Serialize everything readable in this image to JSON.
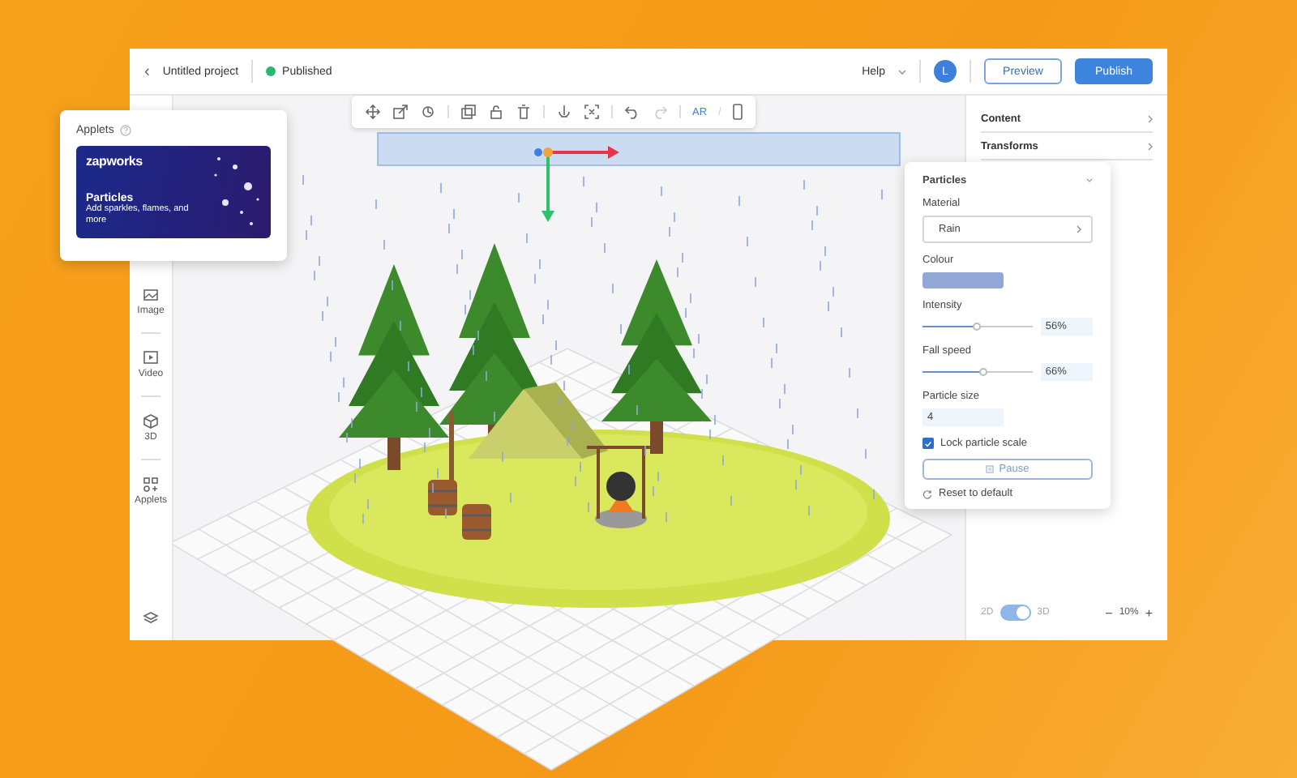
{
  "header": {
    "back": "‹",
    "project": "Untitled project",
    "status": "Published",
    "help": "Help",
    "avatar": "L",
    "preview": "Preview",
    "publish": "Publish"
  },
  "toolbar": {
    "buttons": [
      {
        "kind": "move",
        "disabled": false
      },
      {
        "kind": "scale",
        "disabled": false
      },
      {
        "kind": "rotate",
        "disabled": false
      },
      {
        "kind": "sep"
      },
      {
        "kind": "duplicate",
        "disabled": false
      },
      {
        "kind": "lock",
        "disabled": false
      },
      {
        "kind": "trash",
        "disabled": false
      },
      {
        "kind": "sep"
      },
      {
        "kind": "anchor",
        "disabled": false
      },
      {
        "kind": "fit",
        "disabled": false
      },
      {
        "kind": "sep"
      },
      {
        "kind": "undo",
        "disabled": false
      },
      {
        "kind": "redo",
        "disabled": true
      },
      {
        "kind": "sep"
      }
    ],
    "ar": "AR",
    "slash": "/"
  },
  "sidebar": {
    "items": [
      {
        "label": "Image",
        "kind": "image"
      },
      {
        "label": "Video",
        "kind": "video"
      },
      {
        "label": "3D",
        "kind": "cube"
      },
      {
        "label": "Applets",
        "kind": "applets"
      }
    ]
  },
  "applets_card": {
    "title": "Applets",
    "brand": "zapworks",
    "name": "Particles",
    "description": "Add sparkles, flames, and more"
  },
  "properties": {
    "sections": [
      {
        "label": "Content"
      },
      {
        "label": "Transforms"
      }
    ]
  },
  "particles_panel": {
    "title": "Particles",
    "material_label": "Material",
    "material": "Rain",
    "colour_label": "Colour",
    "color": "#93a8d6",
    "sliders": [
      {
        "label": "Intensity",
        "level": 0.49,
        "reading": "56%"
      },
      {
        "label": "Fall speed",
        "level": 0.55,
        "reading": "66%"
      }
    ],
    "size_label": "Particle size",
    "size": "4",
    "lock": {
      "label": "Lock particle scale",
      "checked": true
    },
    "pause": "Pause",
    "reset": "Reset to default"
  },
  "footer": {
    "mode_2d": "2D",
    "mode_3d": "3D",
    "on": true,
    "zoom_out": "−",
    "zoom": "10%",
    "zoom_in": "+"
  }
}
